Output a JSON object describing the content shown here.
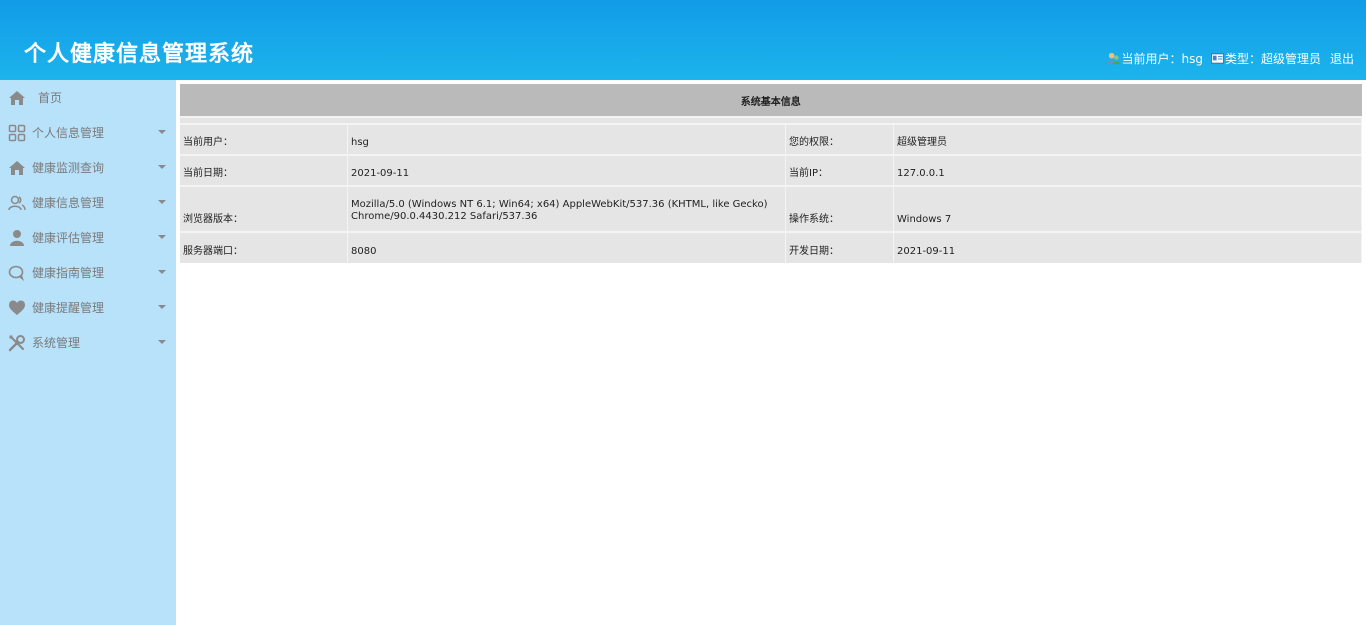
{
  "header": {
    "title": "个人健康信息管理系统",
    "current_user_label": "当前用户：",
    "current_user": "hsg",
    "type_label": "类型：",
    "type_value": "超级管理员",
    "logout": "退出"
  },
  "sidebar": {
    "items": [
      {
        "label": "首页",
        "icon": "home-icon"
      },
      {
        "label": "个人信息管理",
        "icon": "grid-icon"
      },
      {
        "label": "健康监测查询",
        "icon": "house-icon"
      },
      {
        "label": "健康信息管理",
        "icon": "users-icon"
      },
      {
        "label": "健康评估管理",
        "icon": "person-icon"
      },
      {
        "label": "健康指南管理",
        "icon": "chat-icon"
      },
      {
        "label": "健康提醒管理",
        "icon": "heart-icon"
      },
      {
        "label": "系统管理",
        "icon": "tools-icon"
      }
    ]
  },
  "info": {
    "title": "系统基本信息",
    "rows": [
      {
        "k1": "当前用户：",
        "v1": "hsg",
        "k2": "您的权限：",
        "v2": "超级管理员"
      },
      {
        "k1": "当前日期：",
        "v1": "2021-09-11",
        "k2": "当前IP：",
        "v2": "127.0.0.1"
      },
      {
        "k1": "浏览器版本：",
        "v1": "Mozilla/5.0 (Windows NT 6.1; Win64; x64) AppleWebKit/537.36 (KHTML, like Gecko) Chrome/90.0.4430.212 Safari/537.36",
        "k2": "操作系统：",
        "v2": "Windows 7"
      },
      {
        "k1": "服务器端口：",
        "v1": "8080",
        "k2": "开发日期：",
        "v2": "2021-09-11"
      }
    ]
  },
  "colors": {
    "header_top": "#129be8",
    "header_bottom": "#1cb4ec",
    "sidebar_bg": "#b8e2fa",
    "table_head_bg": "#bababa",
    "table_cell_bg": "#e5e5e5",
    "nav_text": "#7a7a7a"
  }
}
